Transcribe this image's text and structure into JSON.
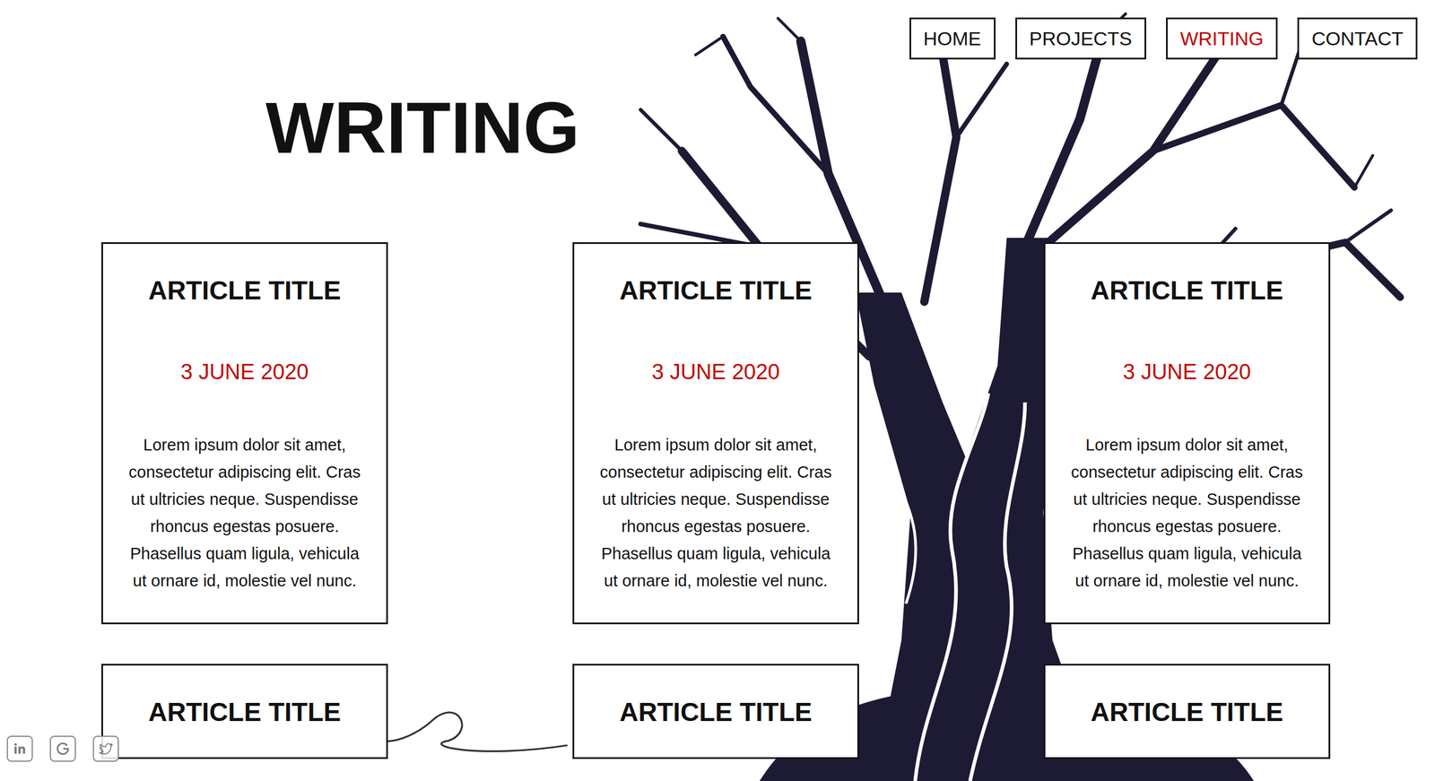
{
  "nav": [
    {
      "label": "HOME",
      "selected": false
    },
    {
      "label": "PROJECTS",
      "selected": false
    },
    {
      "label": "WRITING",
      "selected": true
    },
    {
      "label": "CONTACT",
      "selected": false
    }
  ],
  "page_title": "WRITING",
  "articles": [
    {
      "title": "ARTICLE TITLE",
      "date": "3 JUNE 2020",
      "excerpt": "Lorem ipsum dolor sit amet, consectetur adipiscing elit. Cras ut ultricies neque. Suspendisse rhoncus egestas posuere. Phasellus quam ligula, vehicula ut ornare id, molestie vel nunc."
    },
    {
      "title": "ARTICLE TITLE",
      "date": "3 JUNE 2020",
      "excerpt": "Lorem ipsum dolor sit amet, consectetur adipiscing elit. Cras ut ultricies neque. Suspendisse rhoncus egestas posuere. Phasellus quam ligula, vehicula ut ornare id, molestie vel nunc."
    },
    {
      "title": "ARTICLE TITLE",
      "date": "3 JUNE 2020",
      "excerpt": "Lorem ipsum dolor sit amet, consectetur adipiscing elit. Cras ut ultricies neque. Suspendisse rhoncus egestas posuere. Phasellus quam ligula, vehicula ut ornare id, molestie vel nunc."
    },
    {
      "title": "ARTICLE TITLE"
    },
    {
      "title": "ARTICLE TITLE"
    },
    {
      "title": "ARTICLE TITLE"
    }
  ]
}
